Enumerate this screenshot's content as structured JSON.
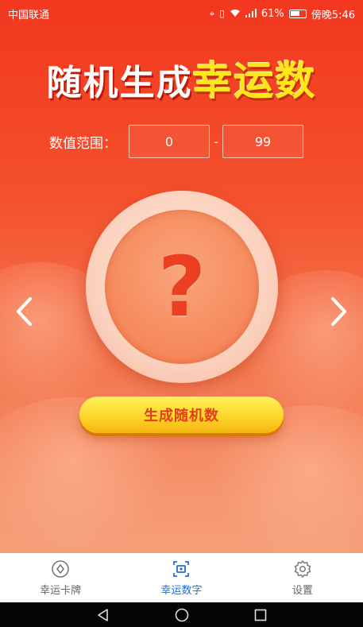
{
  "status_bar": {
    "carrier": "中国联通",
    "battery": "61%",
    "time": "傍晚5:46"
  },
  "header": {
    "title_part1": "随机生成",
    "title_part2": "幸运数"
  },
  "range": {
    "label": "数值范围：",
    "min_value": "0",
    "separator": "-",
    "max_value": "99"
  },
  "result": {
    "placeholder": "?"
  },
  "actions": {
    "generate_label": "生成随机数"
  },
  "bottom_nav": {
    "items": [
      {
        "label": "幸运卡牌",
        "icon": "card-icon",
        "active": false
      },
      {
        "label": "幸运数字",
        "icon": "number-icon",
        "active": true
      },
      {
        "label": "设置",
        "icon": "gear-icon",
        "active": false
      }
    ]
  },
  "colors": {
    "brand_red": "#f2371e",
    "accent_yellow": "#ffe61a",
    "active_tab": "#1e6fd8"
  }
}
